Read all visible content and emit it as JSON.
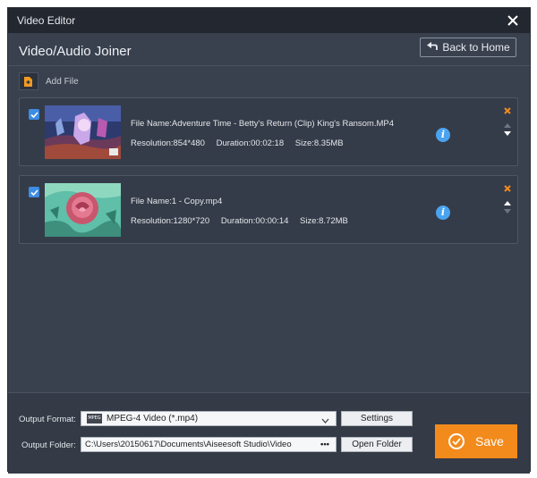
{
  "window": {
    "title": "Video Editor"
  },
  "header": {
    "title": "Video/Audio Joiner",
    "back_label": "Back to Home"
  },
  "toolbar": {
    "add_file_label": "Add File"
  },
  "files": [
    {
      "checked": true,
      "name": "File Name:Adventure Time - Betty's Return (Clip) King's Ransom.MP4",
      "resolution": "Resolution:854*480",
      "duration": "Duration:00:02:18",
      "size": "Size:8.35MB"
    },
    {
      "checked": true,
      "name": "File Name:1 - Copy.mp4",
      "resolution": "Resolution:1280*720",
      "duration": "Duration:00:00:14",
      "size": "Size:8.72MB"
    }
  ],
  "footer": {
    "output_format_label": "Output Format:",
    "output_format_value": "MPEG-4 Video (*.mp4)",
    "format_icon_text": "MPEG",
    "settings_label": "Settings",
    "output_folder_label": "Output Folder:",
    "output_folder_value": "C:\\Users\\20150617\\Documents\\Aiseesoft Studio\\Video",
    "browse_label": "•••",
    "open_folder_label": "Open Folder",
    "save_label": "Save"
  },
  "colors": {
    "window_bg": "#39414f",
    "accent_orange": "#f38a1c",
    "checkbox_blue": "#3d8de2",
    "info_blue": "#4aa3f0"
  }
}
